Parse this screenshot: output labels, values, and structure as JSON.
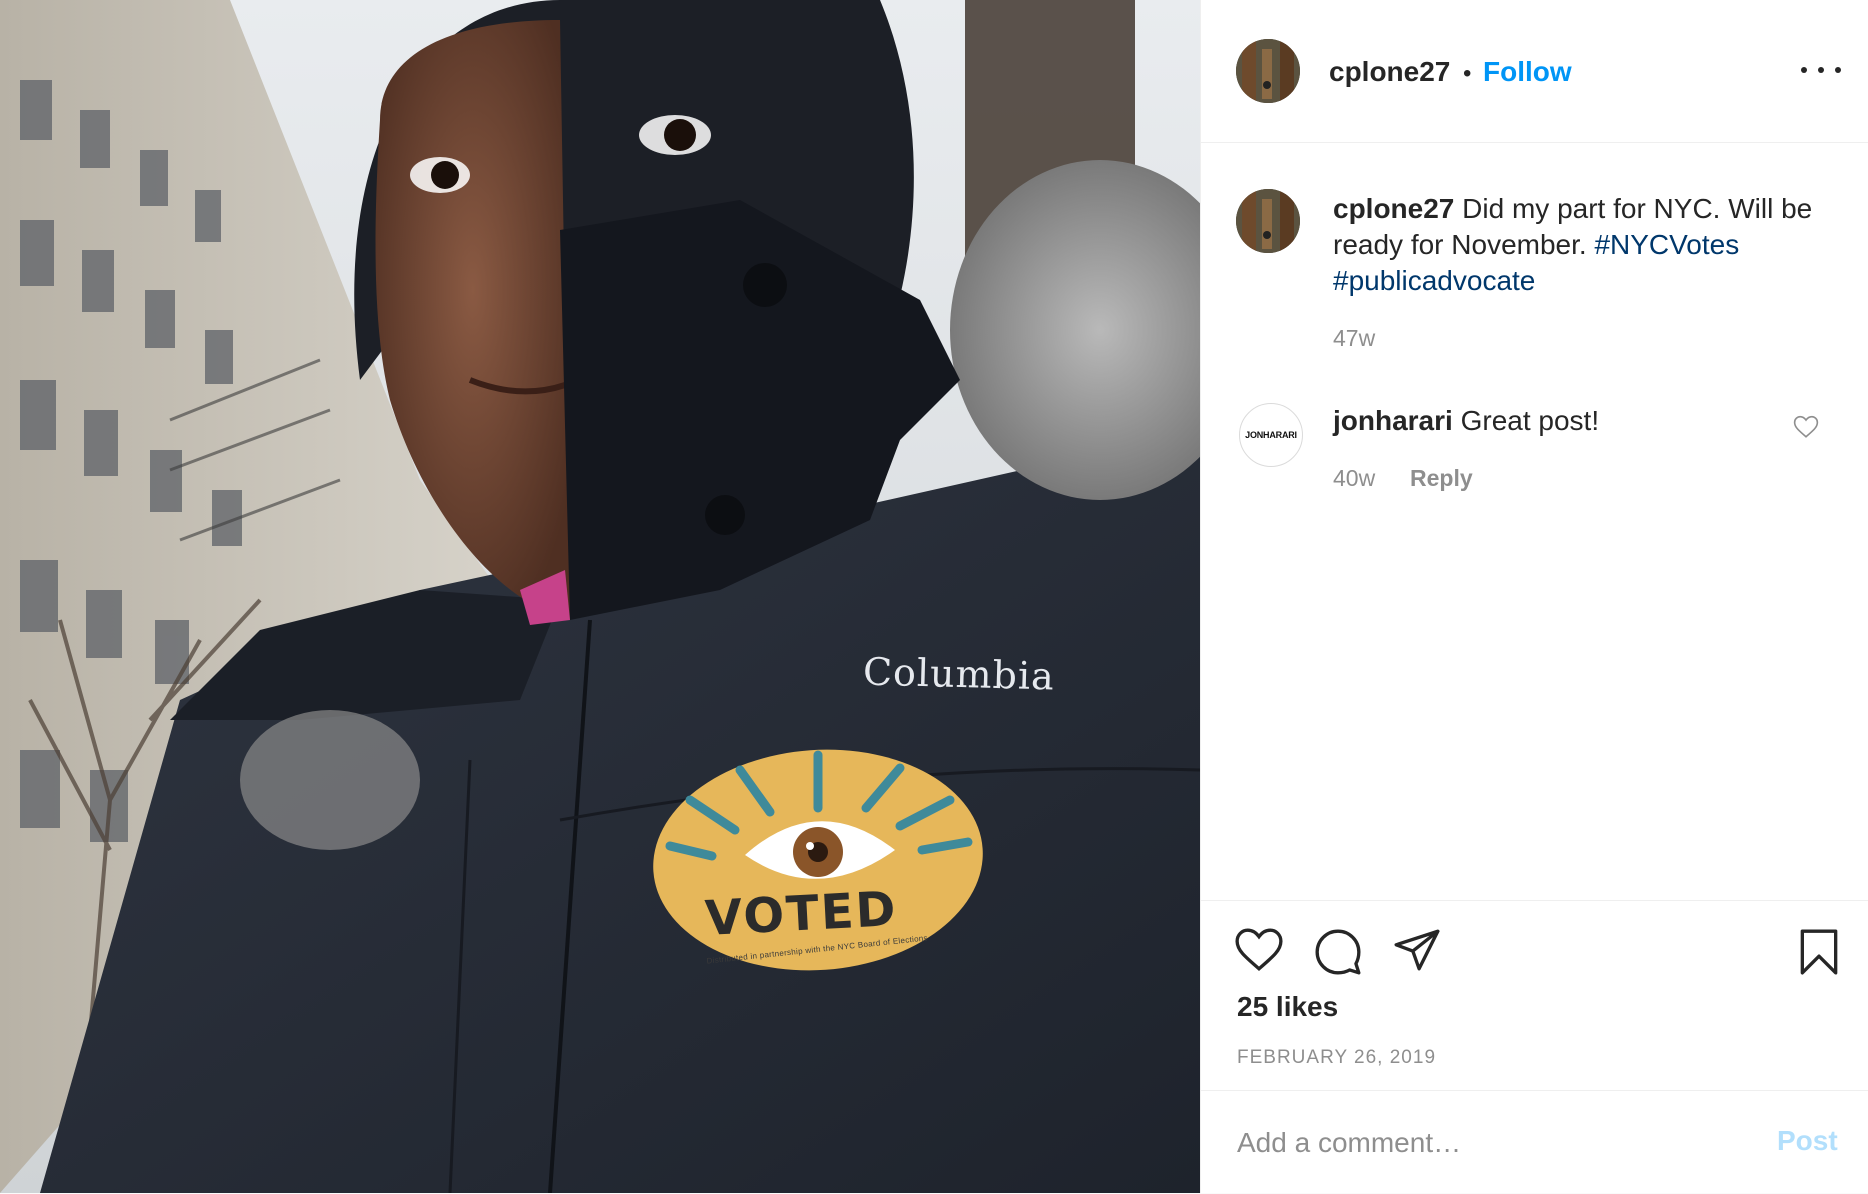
{
  "post": {
    "username": "cplone27",
    "separator": "•",
    "follow_label": "Follow",
    "caption": {
      "username": "cplone27",
      "text": " Did my part for NYC. Will be ready for November. ",
      "hashtags": [
        "#NYCVotes",
        "#publicadvocate"
      ],
      "time": "47w"
    },
    "comments": [
      {
        "avatar_text": "JONHARARI",
        "username": "jonharari",
        "text": " Great post!",
        "time": "40w",
        "reply_label": "Reply"
      }
    ],
    "likes": "25 likes",
    "date": "FEBRUARY 26, 2019",
    "comment_placeholder": "Add a comment…",
    "post_label": "Post"
  },
  "photo": {
    "jacket_brand": "Columbia",
    "sticker_text": "VOTED",
    "sticker_footer": "Distributed in partnership with the NYC Board of Elections",
    "sticker_logo": "nyc votes"
  },
  "colors": {
    "accent": "#0095f6",
    "hashtag": "#00376b",
    "muted": "#8e8e8e",
    "post_disabled": "#b2dffc",
    "sticker": "#e6b75a"
  },
  "icons": [
    "more-options-icon",
    "heart-icon",
    "comment-icon",
    "share-icon",
    "bookmark-icon"
  ]
}
